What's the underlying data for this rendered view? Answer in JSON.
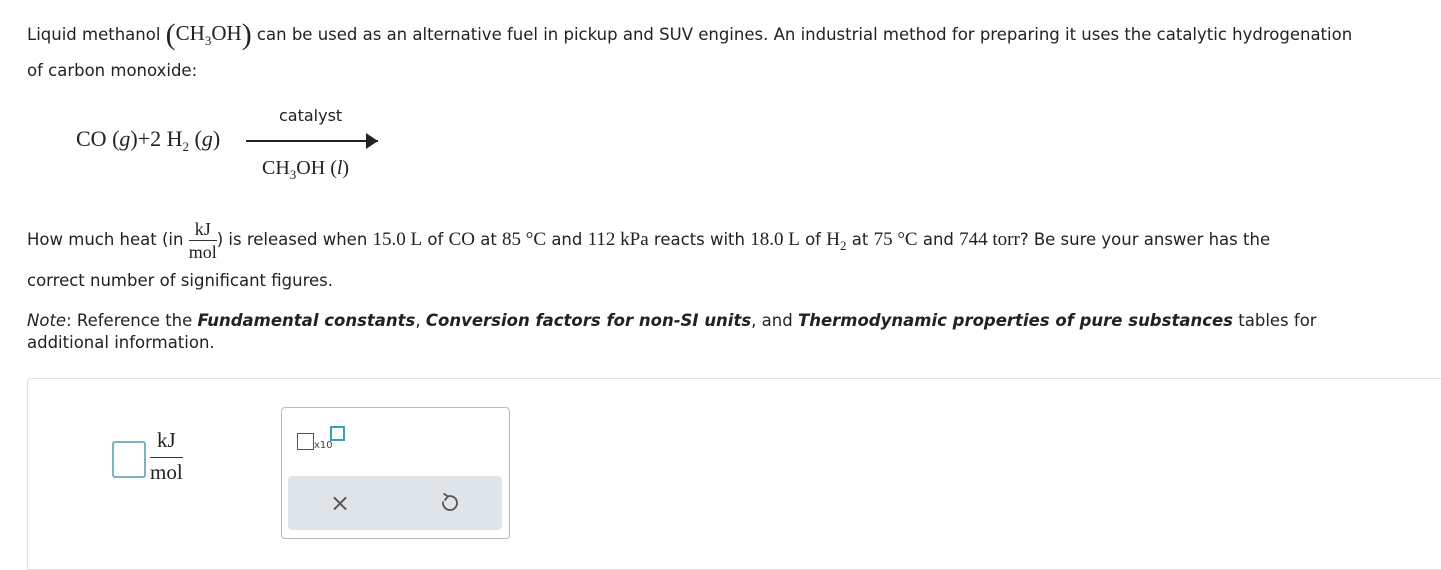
{
  "question": {
    "p1": {
      "a": "Liquid methanol ",
      "formula_main": "CH",
      "formula_sub": "3",
      "formula_end": "OH",
      "b": " can be used as an alternative fuel in pickup and SUV engines. An industrial method for preparing it uses the catalytic hydrogenation",
      "line2": "of carbon monoxide:"
    },
    "reaction": {
      "co": "CO",
      "g": "g",
      "plus": "+2",
      "h2": "H",
      "h2_sub": "2",
      "catalyst": "catalyst",
      "product_main": "CH",
      "product_sub": "3",
      "product_end": "OH",
      "l": "l"
    },
    "p2": {
      "a": "How much heat (in ",
      "unit_num": "kJ",
      "unit_den": "mol",
      "b": ") is released when ",
      "v_co": "15.0 L",
      "c": " of ",
      "co": "CO",
      "d": " at ",
      "t1": "85 °C",
      "e": " and ",
      "p1": "112 kPa",
      "f": " reacts with ",
      "v_h2": "18.0 L",
      "g": " of ",
      "h2": "H",
      "h2_sub": "2",
      "h": " at ",
      "t2": "75 °C",
      "i": " and ",
      "p2": "744 torr",
      "j": "? Be sure your answer has the",
      "line2": "correct number of significant figures."
    },
    "note": {
      "label": "Note",
      "a": ": Reference the ",
      "t1": "Fundamental constants",
      "b": ", ",
      "t2": "Conversion factors for non-SI units",
      "c": ", and ",
      "t3": "Thermodynamic properties of pure substances",
      "d": " tables for",
      "line2": "additional information."
    }
  },
  "answer": {
    "value": "",
    "unit_num": "kJ",
    "unit_den": "mol"
  },
  "tools": {
    "x10_label": "x10",
    "clear_symbol": "×"
  },
  "colors": {
    "accent": "#3aa0b8",
    "input_border": "#7fb1c5",
    "button_bar": "#dee4e8"
  }
}
